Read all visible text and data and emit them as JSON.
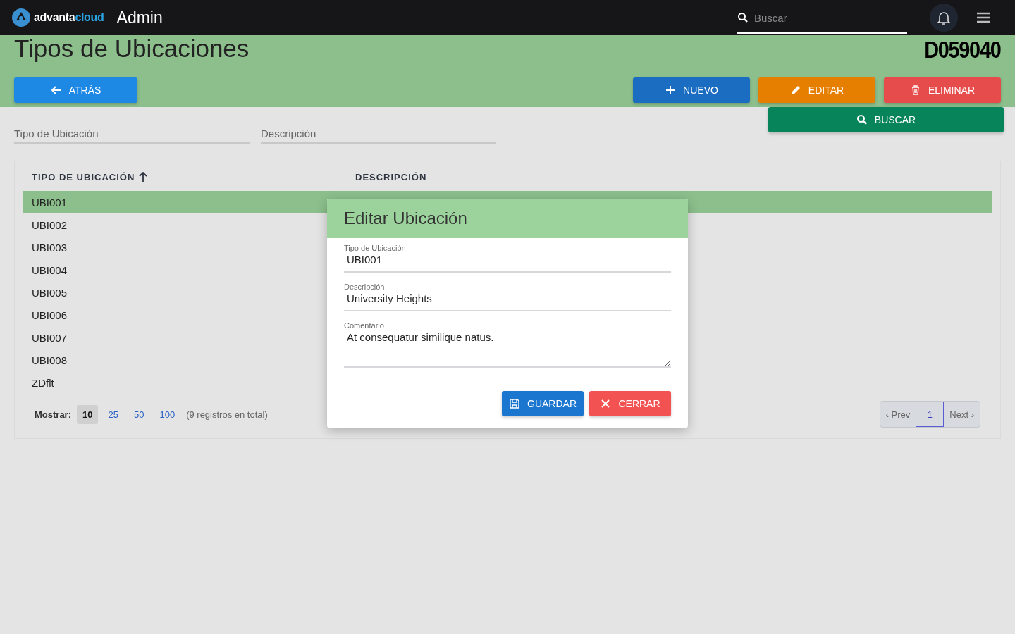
{
  "topbar": {
    "brand": {
      "part1": "advanta",
      "part2": "cloud"
    },
    "section": "Admin",
    "search": {
      "placeholder": "Buscar"
    }
  },
  "header": {
    "title": "Tipos de Ubicaciones",
    "code": "D059040",
    "back_button": "ATRÁS",
    "actions": [
      {
        "label": "NUEVO",
        "kind": "new"
      },
      {
        "label": "EDITAR",
        "kind": "edit"
      },
      {
        "label": "ELIMINAR",
        "kind": "delete"
      }
    ]
  },
  "filters": {
    "fields": [
      {
        "placeholder": "Tipo de Ubicación"
      },
      {
        "placeholder": "Descripción"
      }
    ],
    "search_button": "BUSCAR"
  },
  "table": {
    "columns": [
      {
        "label": "TIPO DE UBICACIÓN",
        "sorted": true
      },
      {
        "label": "DESCRIPCIÓN",
        "sorted": false
      }
    ],
    "rows": [
      {
        "type": "UBI001",
        "selected": true
      },
      {
        "type": "UBI002",
        "selected": false
      },
      {
        "type": "UBI003",
        "selected": false
      },
      {
        "type": "UBI004",
        "selected": false
      },
      {
        "type": "UBI005",
        "selected": false
      },
      {
        "type": "UBI006",
        "selected": false
      },
      {
        "type": "UBI007",
        "selected": false
      },
      {
        "type": "UBI008",
        "selected": false
      },
      {
        "type": "ZDflt",
        "selected": false
      }
    ]
  },
  "pagination": {
    "label": "Mostrar:",
    "sizes": [
      {
        "label": "10",
        "selected": true
      },
      {
        "label": "25",
        "selected": false
      },
      {
        "label": "50",
        "selected": false
      },
      {
        "label": "100",
        "selected": false
      }
    ],
    "total": "(9 registros en total)",
    "prev": "‹ Prev",
    "pages": [
      {
        "label": "1",
        "selected": true
      }
    ],
    "next": "Next ›"
  },
  "dialog": {
    "title": "Editar Ubicación",
    "fields": [
      {
        "label": "Tipo de Ubicación",
        "value": "UBI001",
        "kind": "input"
      },
      {
        "label": "Descripción",
        "value": "University Heights",
        "kind": "input"
      },
      {
        "label": "Comentario",
        "value": "At consequatur similique natus.",
        "kind": "textarea"
      }
    ],
    "buttons": [
      {
        "label": "GUARDAR",
        "kind": "save"
      },
      {
        "label": "CERRAR",
        "kind": "close"
      }
    ]
  }
}
